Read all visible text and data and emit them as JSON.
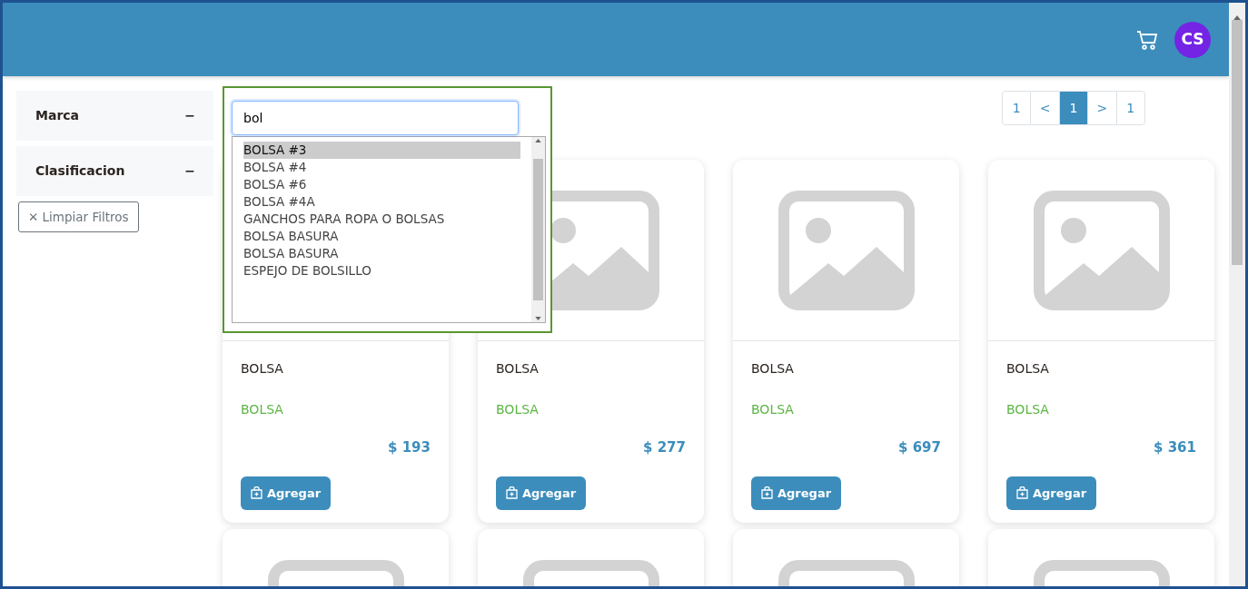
{
  "header": {
    "avatar": "CS"
  },
  "filters": [
    {
      "label": "Marca",
      "toggle": "−",
      "expanded": true
    },
    {
      "label": "Clasificacion",
      "toggle": "−",
      "expanded": true
    }
  ],
  "clear_button": {
    "icon": "✕",
    "label": "Limpiar Filtros"
  },
  "search": {
    "value": "bol",
    "suggestions": [
      {
        "label": "BOLSA #3",
        "selected": true
      },
      {
        "label": "BOLSA #4",
        "selected": false
      },
      {
        "label": "BOLSA #6",
        "selected": false
      },
      {
        "label": "BOLSA #4A",
        "selected": false
      },
      {
        "label": "GANCHOS PARA ROPA O BOLSAS",
        "selected": false
      },
      {
        "label": "BOLSA BASURA",
        "selected": false
      },
      {
        "label": "BOLSA BASURA",
        "selected": false
      },
      {
        "label": "ESPEJO DE BOLSILLO",
        "selected": false
      }
    ]
  },
  "pagination": [
    {
      "label": "1",
      "selected": false
    },
    {
      "label": "<",
      "selected": false
    },
    {
      "label": "1",
      "selected": true
    },
    {
      "label": ">",
      "selected": false
    },
    {
      "label": "1",
      "selected": false
    }
  ],
  "products": [
    {
      "kind": "full",
      "name": "BOLSA",
      "brand": "BOLSA",
      "price": "$ 193",
      "button": "Agregar"
    },
    {
      "kind": "full",
      "name": "BOLSA",
      "brand": "BOLSA",
      "price": "$ 277",
      "button": "Agregar"
    },
    {
      "kind": "full",
      "name": "BOLSA",
      "brand": "BOLSA",
      "price": "$ 697",
      "button": "Agregar"
    },
    {
      "kind": "full",
      "name": "BOLSA",
      "brand": "BOLSA",
      "price": "$ 361",
      "button": "Agregar"
    },
    {
      "kind": "image_only"
    },
    {
      "kind": "image_only"
    },
    {
      "kind": "image_only"
    },
    {
      "kind": "image_only"
    }
  ]
}
